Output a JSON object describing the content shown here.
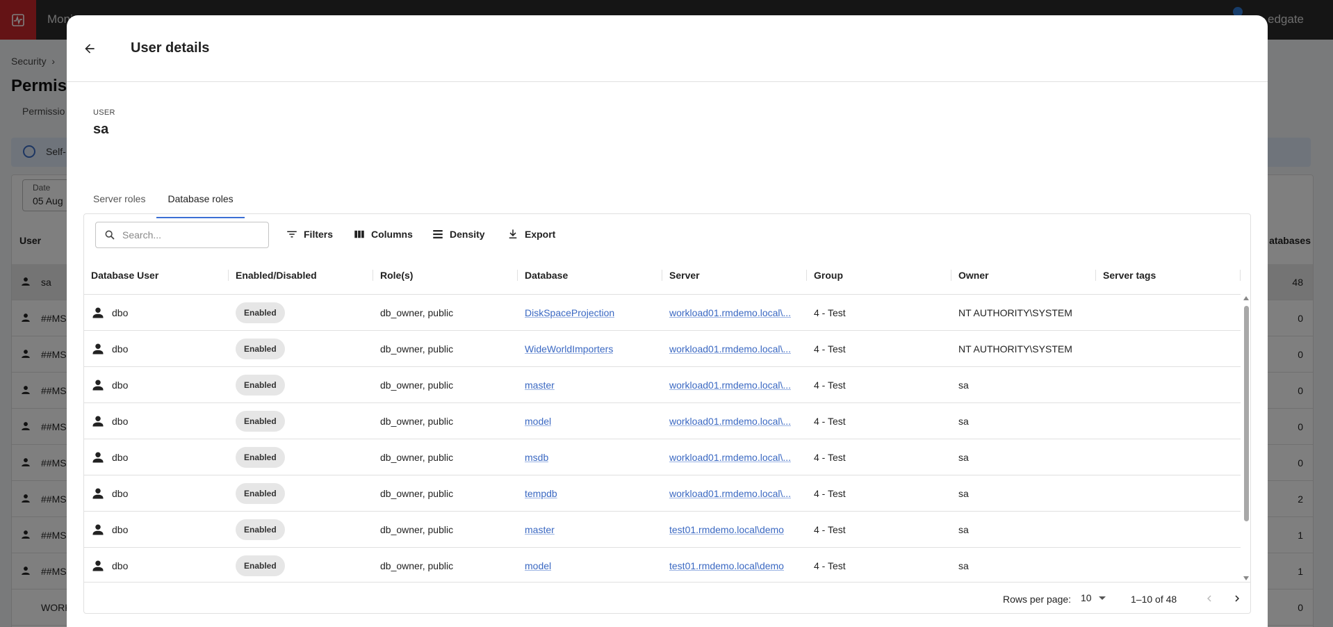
{
  "background": {
    "app_name": "Moni",
    "brand": "edgate",
    "breadcrumb": "Security",
    "page_title": "Permiss",
    "subtab": "Permissio",
    "info_text": "Self-",
    "date_label": "Date",
    "date_value": "05 Aug",
    "col_user": "User",
    "col_databases": "atabases",
    "rows": [
      {
        "name": "sa",
        "count": "48"
      },
      {
        "name": "##MS",
        "count": "0"
      },
      {
        "name": "##MS",
        "count": "0"
      },
      {
        "name": "##MS",
        "count": "0"
      },
      {
        "name": "##MS",
        "count": "0"
      },
      {
        "name": "##MS",
        "count": "0"
      },
      {
        "name": "##MS",
        "count": "2"
      },
      {
        "name": "##MS",
        "count": "1"
      },
      {
        "name": "##MS",
        "count": "1"
      },
      {
        "name": "WORK",
        "count": "0"
      }
    ]
  },
  "modal": {
    "title": "User details",
    "user_label": "USER",
    "user_value": "sa",
    "tabs": [
      {
        "label": "Server roles",
        "active": false
      },
      {
        "label": "Database roles",
        "active": true
      }
    ]
  },
  "toolbar": {
    "search_placeholder": "Search...",
    "filters": "Filters",
    "columns": "Columns",
    "density": "Density",
    "export": "Export"
  },
  "table": {
    "columns": [
      "Database User",
      "Enabled/Disabled",
      "Role(s)",
      "Database",
      "Server",
      "Group",
      "Owner",
      "Server tags"
    ],
    "rows": [
      {
        "user": "dbo",
        "status": "Enabled",
        "roles": "db_owner, public",
        "database": "DiskSpaceProjection",
        "server": "workload01.rmdemo.local\\...",
        "group": "4 - Test",
        "owner": "NT AUTHORITY\\SYSTEM",
        "tags": ""
      },
      {
        "user": "dbo",
        "status": "Enabled",
        "roles": "db_owner, public",
        "database": "WideWorldImporters",
        "server": "workload01.rmdemo.local\\...",
        "group": "4 - Test",
        "owner": "NT AUTHORITY\\SYSTEM",
        "tags": ""
      },
      {
        "user": "dbo",
        "status": "Enabled",
        "roles": "db_owner, public",
        "database": "master",
        "server": "workload01.rmdemo.local\\...",
        "group": "4 - Test",
        "owner": "sa",
        "tags": ""
      },
      {
        "user": "dbo",
        "status": "Enabled",
        "roles": "db_owner, public",
        "database": "model",
        "server": "workload01.rmdemo.local\\...",
        "group": "4 - Test",
        "owner": "sa",
        "tags": ""
      },
      {
        "user": "dbo",
        "status": "Enabled",
        "roles": "db_owner, public",
        "database": "msdb",
        "server": "workload01.rmdemo.local\\...",
        "group": "4 - Test",
        "owner": "sa",
        "tags": ""
      },
      {
        "user": "dbo",
        "status": "Enabled",
        "roles": "db_owner, public",
        "database": "tempdb",
        "server": "workload01.rmdemo.local\\...",
        "group": "4 - Test",
        "owner": "sa",
        "tags": ""
      },
      {
        "user": "dbo",
        "status": "Enabled",
        "roles": "db_owner, public",
        "database": "master",
        "server": "test01.rmdemo.local\\demo",
        "group": "4 - Test",
        "owner": "sa",
        "tags": ""
      },
      {
        "user": "dbo",
        "status": "Enabled",
        "roles": "db_owner, public",
        "database": "model",
        "server": "test01.rmdemo.local\\demo",
        "group": "4 - Test",
        "owner": "sa",
        "tags": ""
      }
    ]
  },
  "pagination": {
    "rows_per_page_label": "Rows per page:",
    "rows_per_page_value": "10",
    "range": "1–10 of 48"
  },
  "colors": {
    "accent": "#3b6fd4",
    "link": "#3a68c2",
    "brand_red": "#c8262b",
    "topbar": "#2b2b2b"
  }
}
